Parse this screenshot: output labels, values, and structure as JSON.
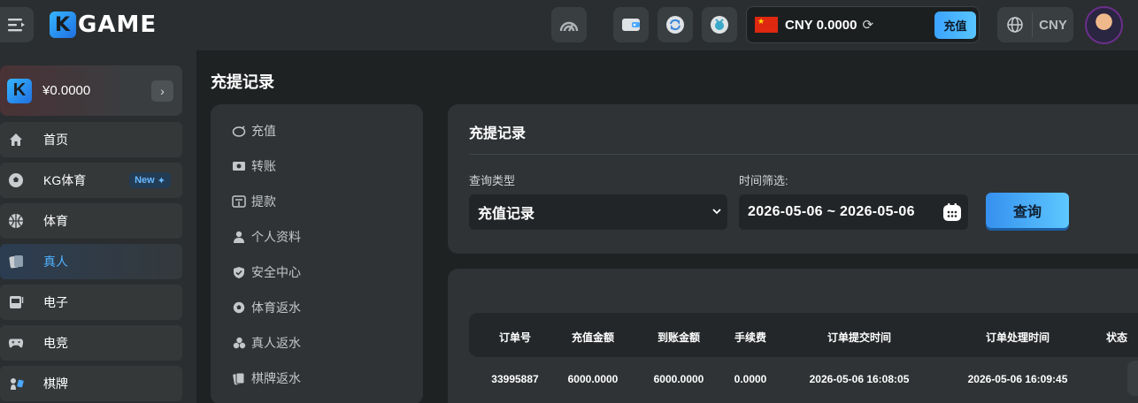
{
  "header": {
    "logo_text": "GAME",
    "logo_letter": "K",
    "currency_code": "CNY",
    "balance": "0.0000",
    "recharge_label": "充值",
    "language_currency": "CNY"
  },
  "sidebar": {
    "wallet_letter": "K",
    "wallet_amount": "¥0.0000",
    "items": [
      {
        "label": "首页",
        "icon": "home-icon"
      },
      {
        "label": "KG体育",
        "icon": "soccer-ball-icon",
        "badge": "New"
      },
      {
        "label": "体育",
        "icon": "basketball-icon"
      },
      {
        "label": "真人",
        "icon": "cards-icon",
        "active": true
      },
      {
        "label": "电子",
        "icon": "slot-machine-icon"
      },
      {
        "label": "电竞",
        "icon": "gamepad-icon"
      },
      {
        "label": "棋牌",
        "icon": "chess-icon"
      }
    ]
  },
  "page": {
    "title": "充提记录"
  },
  "submenu": {
    "items": [
      {
        "label": "充值",
        "icon": "piggy-bank-icon"
      },
      {
        "label": "转账",
        "icon": "money-icon"
      },
      {
        "label": "提款",
        "icon": "withdraw-icon"
      },
      {
        "label": "个人资料",
        "icon": "user-icon"
      },
      {
        "label": "安全中心",
        "icon": "shield-icon"
      },
      {
        "label": "体育返水",
        "icon": "soccer-ball-icon"
      },
      {
        "label": "真人返水",
        "icon": "chips-icon"
      },
      {
        "label": "棋牌返水",
        "icon": "card-deck-icon"
      }
    ]
  },
  "filter": {
    "title": "充提记录",
    "query_type_label": "查询类型",
    "query_type_value": "充值记录",
    "time_label": "时间筛选:",
    "date_range": "2026-05-06 ~ 2026-05-06",
    "query_button": "查询"
  },
  "table": {
    "columns": [
      "订单号",
      "充值金额",
      "到账金额",
      "手续费",
      "订单提交时间",
      "订单处理时间",
      "状态"
    ],
    "rows": [
      [
        "33995887",
        "6000.0000",
        "6000.0000",
        "0.0000",
        "2026-05-06 16:08:05",
        "2026-05-06 16:09:45"
      ]
    ]
  },
  "colors": {
    "accent": "#4fb4ff",
    "button_gradient_start": "#3590ee",
    "button_gradient_end": "#5ec8ff",
    "background": "#1f2223",
    "panel": "#2f3335"
  }
}
